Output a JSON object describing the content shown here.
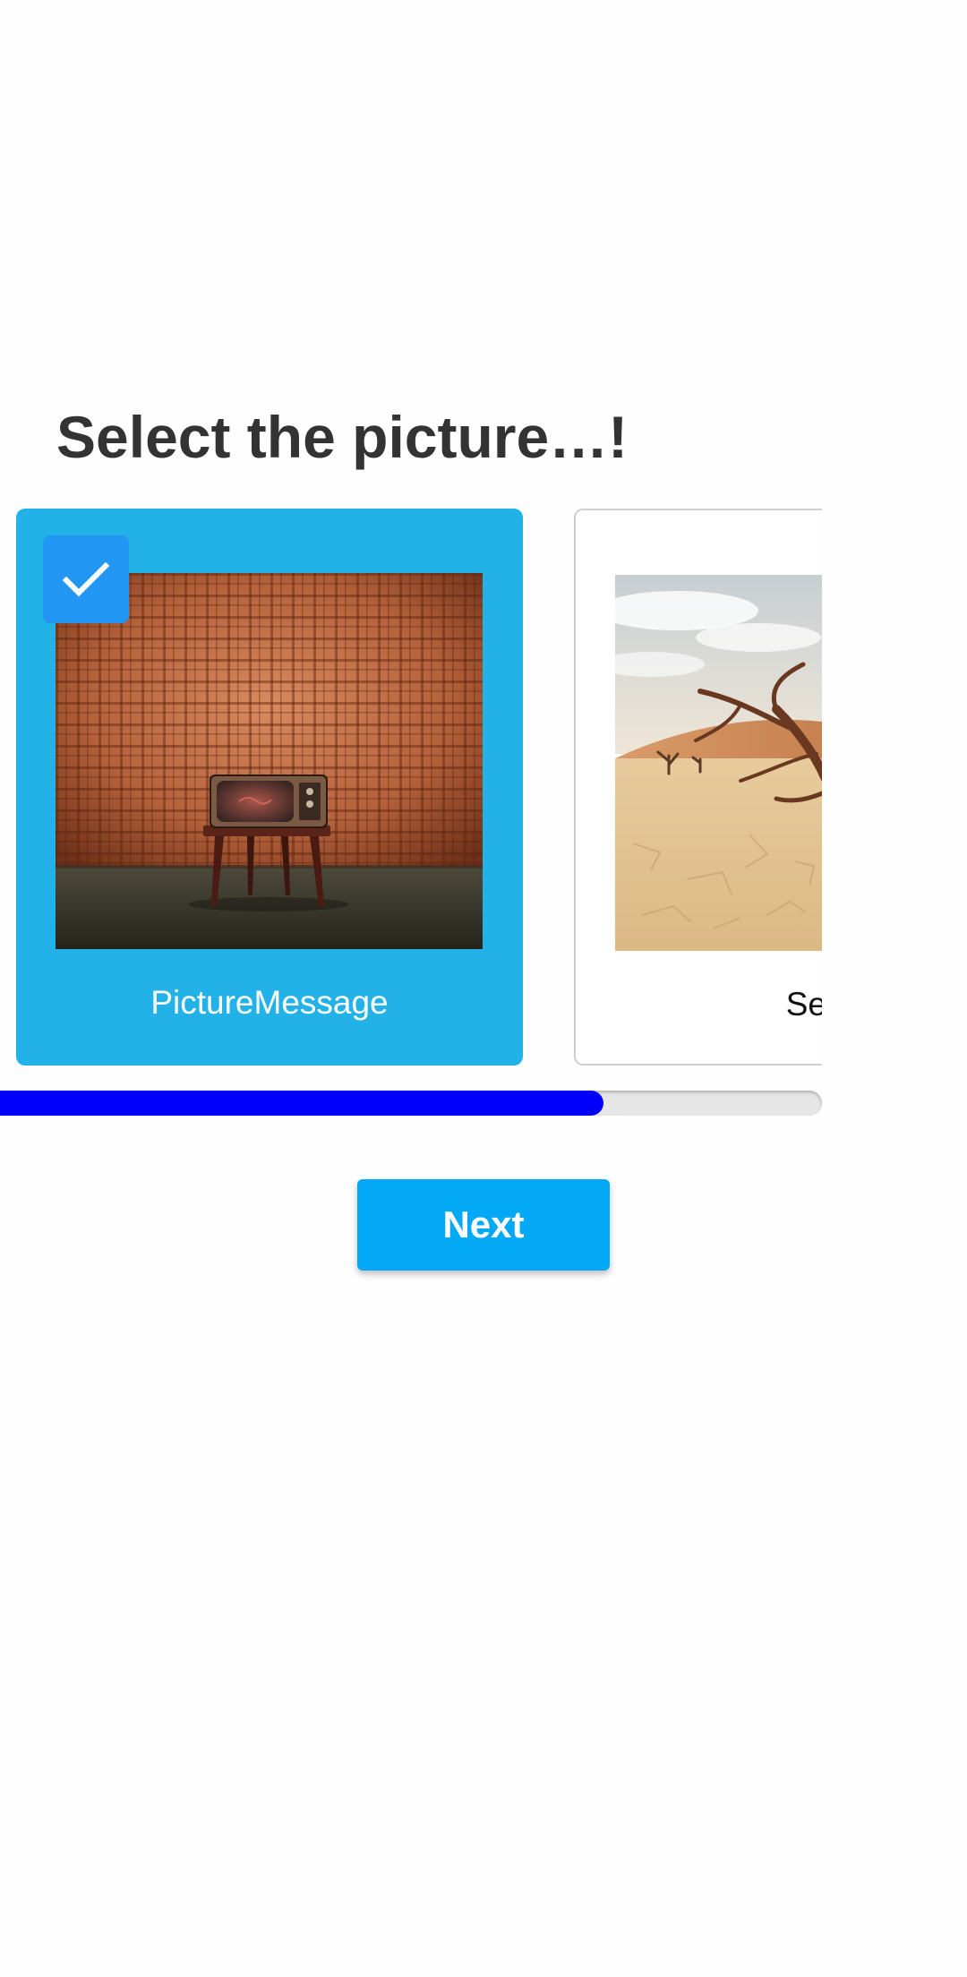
{
  "screen": {
    "title": "Select the picture…!"
  },
  "cards": [
    {
      "label": "PictureMessage",
      "selected": true,
      "image": "retro-tv-on-stool-against-plaid-wall"
    },
    {
      "label": "Selec",
      "selected": false,
      "image": "dead-tree-in-desert-clay-pan"
    }
  ],
  "selection": {
    "check_icon": "check-icon"
  },
  "progress": {
    "fraction": 0.74
  },
  "actions": {
    "next_label": "Next"
  },
  "colors": {
    "selected_card": "#23b2e8",
    "check_badge": "#2196f3",
    "progress_fill": "#0000ff",
    "next_button": "#03a9f4",
    "title_text": "#333333"
  }
}
